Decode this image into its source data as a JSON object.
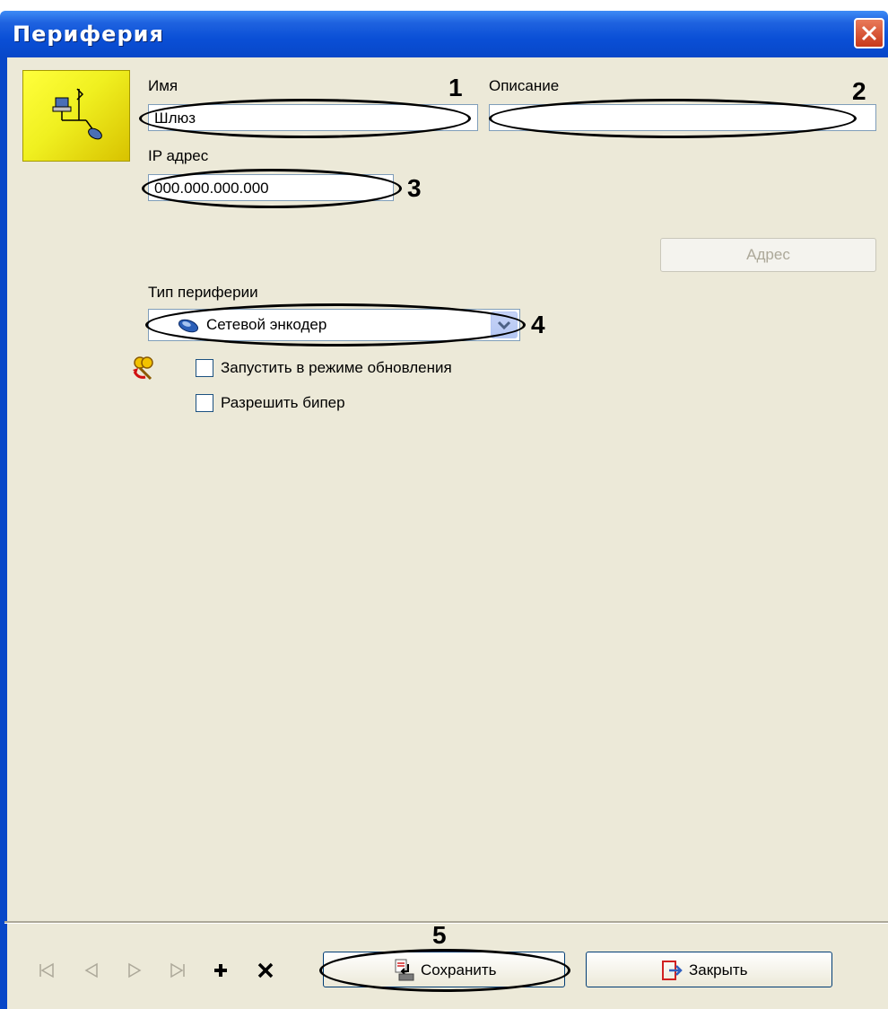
{
  "window": {
    "title": "Периферия"
  },
  "form": {
    "name_label": "Имя",
    "name_value": "Шлюз",
    "description_label": "Описание",
    "description_value": "",
    "ip_label": "IP адрес",
    "ip_value": "000.000.000.000",
    "address_button": "Адрес",
    "peripheral_type_label": "Тип периферии",
    "peripheral_type_value": "Сетевой энкодер",
    "checkbox_update_label": "Запустить в режиме обновления",
    "checkbox_update_checked": false,
    "checkbox_beeper_label": "Разрешить бипер",
    "checkbox_beeper_checked": false
  },
  "annotations": {
    "n1": "1",
    "n2": "2",
    "n3": "3",
    "n4": "4",
    "n5": "5"
  },
  "footer": {
    "nav_icons": [
      "first-record-icon",
      "previous-record-icon",
      "next-record-icon",
      "last-record-icon",
      "add-icon",
      "delete-icon"
    ],
    "save_button": "Сохранить",
    "close_button": "Закрыть"
  },
  "colors": {
    "title_bar": "#0a4fd6",
    "dialog_bg": "#ece9d8",
    "close_button": "#c8381a",
    "icon_bg": "#f0f020"
  }
}
